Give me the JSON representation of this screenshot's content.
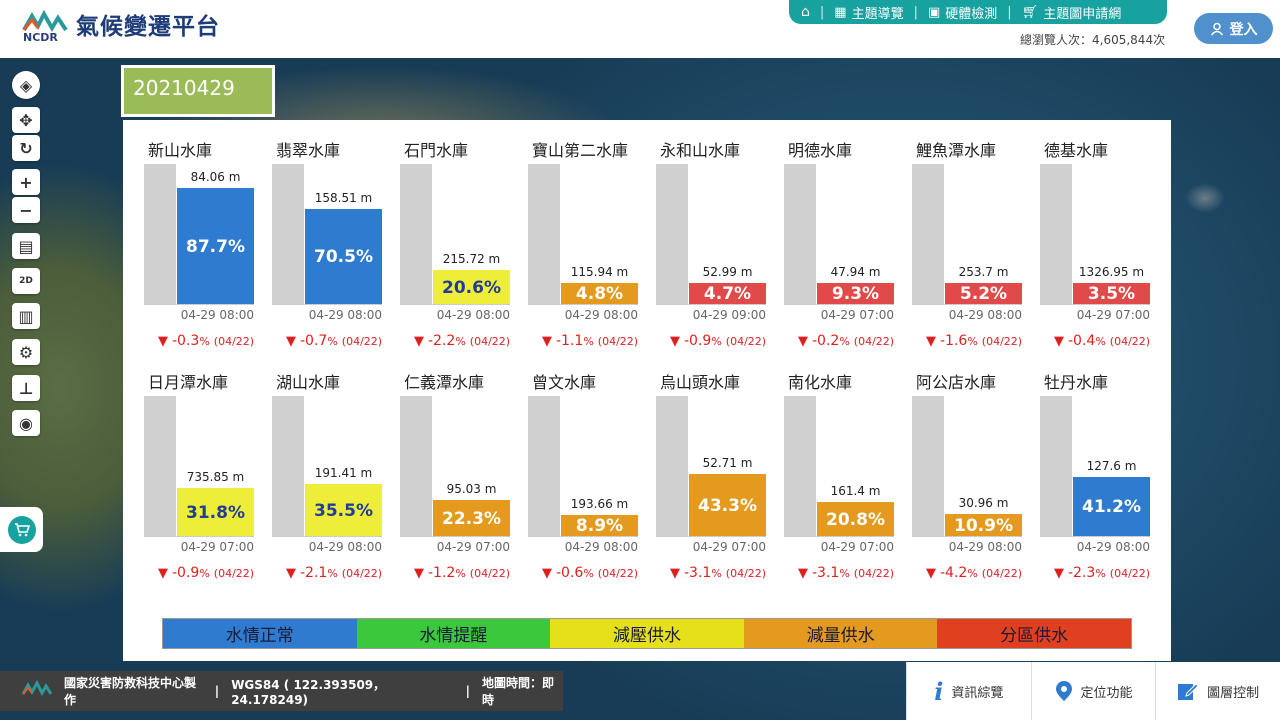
{
  "header": {
    "title": "氣候變遷平台",
    "logo_text": "NCDR",
    "nav": [
      "主題導覽",
      "硬體檢測",
      "主題圖申請網"
    ],
    "visitors": "總瀏覽人次：4,605,844次",
    "login": "登入"
  },
  "date": "20210429",
  "reservoirs": [
    {
      "name": "新山水庫",
      "level": "84.06 m",
      "pct": "87.7%",
      "fill": 0.877,
      "color": "#2e7bd0",
      "time": "04-29 08:00",
      "change": "-0.3",
      "date": "(04/22)"
    },
    {
      "name": "翡翠水庫",
      "level": "158.51 m",
      "pct": "70.5%",
      "fill": 0.705,
      "color": "#2e7bd0",
      "time": "04-29 08:00",
      "change": "-0.7",
      "date": "(04/22)"
    },
    {
      "name": "石門水庫",
      "level": "215.72 m",
      "pct": "20.6%",
      "fill": 0.206,
      "color": "#eded3a",
      "time": "04-29 08:00",
      "change": "-2.2",
      "date": "(04/22)"
    },
    {
      "name": "寶山第二水庫",
      "level": "115.94 m",
      "pct": "4.8%",
      "fill": 0.048,
      "color": "#e39a1f",
      "time": "04-29 08:00",
      "change": "-1.1",
      "date": "(04/22)"
    },
    {
      "name": "永和山水庫",
      "level": "52.99 m",
      "pct": "4.7%",
      "fill": 0.047,
      "color": "#e14a4a",
      "time": "04-29 09:00",
      "change": "-0.9",
      "date": "(04/22)"
    },
    {
      "name": "明德水庫",
      "level": "47.94 m",
      "pct": "9.3%",
      "fill": 0.093,
      "color": "#e14a4a",
      "time": "04-29 07:00",
      "change": "-0.2",
      "date": "(04/22)"
    },
    {
      "name": "鯉魚潭水庫",
      "level": "253.7 m",
      "pct": "5.2%",
      "fill": 0.052,
      "color": "#e14a4a",
      "time": "04-29 08:00",
      "change": "-1.6",
      "date": "(04/22)"
    },
    {
      "name": "德基水庫",
      "level": "1326.95 m",
      "pct": "3.5%",
      "fill": 0.035,
      "color": "#e14a4a",
      "time": "04-29 07:00",
      "change": "-0.4",
      "date": "(04/22)"
    },
    {
      "name": "日月潭水庫",
      "level": "735.85 m",
      "pct": "31.8%",
      "fill": 0.318,
      "color": "#eded3a",
      "time": "04-29 07:00",
      "change": "-0.9",
      "date": "(04/22)"
    },
    {
      "name": "湖山水庫",
      "level": "191.41 m",
      "pct": "35.5%",
      "fill": 0.355,
      "color": "#eded3a",
      "time": "04-29 08:00",
      "change": "-2.1",
      "date": "(04/22)"
    },
    {
      "name": "仁義潭水庫",
      "level": "95.03 m",
      "pct": "22.3%",
      "fill": 0.223,
      "color": "#e39a1f",
      "time": "04-29 07:00",
      "change": "-1.2",
      "date": "(04/22)"
    },
    {
      "name": "曾文水庫",
      "level": "193.66 m",
      "pct": "8.9%",
      "fill": 0.089,
      "color": "#e39a1f",
      "time": "04-29 08:00",
      "change": "-0.6",
      "date": "(04/22)"
    },
    {
      "name": "烏山頭水庫",
      "level": "52.71 m",
      "pct": "43.3%",
      "fill": 0.433,
      "color": "#e39a1f",
      "time": "04-29 07:00",
      "change": "-3.1",
      "date": "(04/22)"
    },
    {
      "name": "南化水庫",
      "level": "161.4 m",
      "pct": "20.8%",
      "fill": 0.208,
      "color": "#e39a1f",
      "time": "04-29 07:00",
      "change": "-3.1",
      "date": "(04/22)"
    },
    {
      "name": "阿公店水庫",
      "level": "30.96 m",
      "pct": "10.9%",
      "fill": 0.109,
      "color": "#e39a1f",
      "time": "04-29 08:00",
      "change": "-4.2",
      "date": "(04/22)"
    },
    {
      "name": "牡丹水庫",
      "level": "127.6 m",
      "pct": "41.2%",
      "fill": 0.412,
      "color": "#2e7bd0",
      "time": "04-29 08:00",
      "change": "-2.3",
      "date": "(04/22)"
    }
  ],
  "legend": [
    {
      "label": "水情正常",
      "color": "#2e7bd0"
    },
    {
      "label": "水情提醒",
      "color": "#3cc83c"
    },
    {
      "label": "減壓供水",
      "color": "#e5e01a"
    },
    {
      "label": "減量供水",
      "color": "#e39a1f"
    },
    {
      "label": "分區供水",
      "color": "#e0401f"
    }
  ],
  "footer": {
    "org": "國家災害防救科技中心製作",
    "coords": "WGS84 ( 122.393509，24.178249)",
    "map_time": "地圖時間：即時"
  },
  "bottom_tools": [
    "資訊綜覽",
    "定位功能",
    "圖層控制"
  ]
}
